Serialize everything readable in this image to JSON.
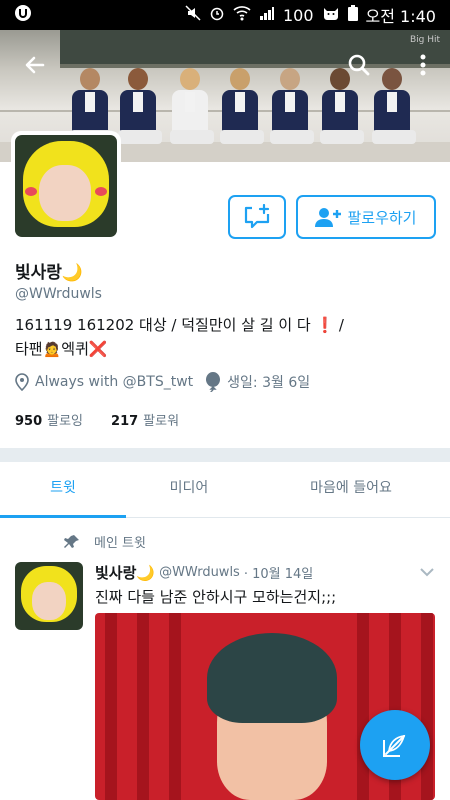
{
  "status_bar": {
    "battery_text": "100",
    "time": "오전 1:40",
    "icons": [
      "app-icon",
      "mute-icon",
      "alarm-icon",
      "wifi-icon",
      "signal-icon",
      "cat-icon",
      "battery-icon"
    ]
  },
  "header": {
    "watermark": "Big Hit",
    "back_icon": "arrow-left-icon",
    "search_icon": "search-icon",
    "more_icon": "more-vertical-icon"
  },
  "profile": {
    "name": "빛사랑🌙",
    "handle": "@WWrduwls",
    "bio_line1": "161119 161202 대상  /  덕질만이 살 길 이 다 ❗  /",
    "bio_line2": "타팬🙍엑퀴❌",
    "location": "Always with @BTS_twt",
    "birthday": "생일: 3월 6일",
    "following_count": "950",
    "following_label": "팔로잉",
    "followers_count": "217",
    "followers_label": "팔로워"
  },
  "actions": {
    "follow_label": "팔로우하기"
  },
  "tabs": [
    {
      "label": "트윗",
      "active": true
    },
    {
      "label": "미디어",
      "active": false
    },
    {
      "label": "마음에 들어요",
      "active": false
    }
  ],
  "pinned": {
    "label": "메인 트윗"
  },
  "tweet": {
    "name": "빛사랑🌙",
    "handle": "@WWrduwls",
    "date": "· 10월 14일",
    "text": "진짜 다들 남준 안하시구 모하는건지;;;"
  },
  "colors": {
    "accent": "#1da1f2",
    "muted": "#657786"
  }
}
